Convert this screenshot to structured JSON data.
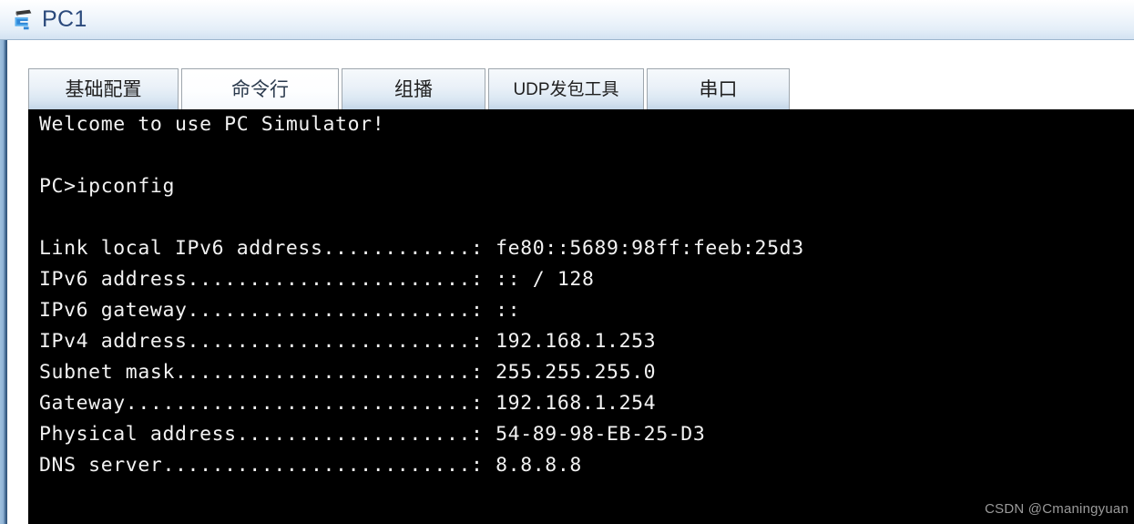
{
  "window": {
    "title": "PC1",
    "icon": "switch-icon"
  },
  "tabs": [
    {
      "label": "基础配置",
      "active": false
    },
    {
      "label": "命令行",
      "active": true
    },
    {
      "label": "组播",
      "active": false
    },
    {
      "label": "UDP发包工具",
      "active": false
    },
    {
      "label": "串口",
      "active": false
    }
  ],
  "terminal": {
    "background": "#000000",
    "foreground": "#f2f2f2",
    "label_width": 35,
    "lines": [
      {
        "text": "Welcome to use PC Simulator!"
      },
      {
        "text": ""
      },
      {
        "text": "PC>ipconfig"
      },
      {
        "text": ""
      },
      {
        "label": "Link local IPv6 address",
        "value": "fe80::5689:98ff:feeb:25d3"
      },
      {
        "label": "IPv6 address",
        "value": ":: / 128"
      },
      {
        "label": "IPv6 gateway",
        "value": "::"
      },
      {
        "label": "IPv4 address",
        "value": "192.168.1.253"
      },
      {
        "label": "Subnet mask",
        "value": "255.255.255.0"
      },
      {
        "label": "Gateway",
        "value": "192.168.1.254"
      },
      {
        "label": "Physical address",
        "value": "54-89-98-EB-25-D3"
      },
      {
        "label": "DNS server",
        "value": "8.8.8.8"
      }
    ],
    "prompt": "PC>",
    "command": "ipconfig",
    "welcome": "Welcome to use PC Simulator!"
  },
  "watermark": {
    "text": "CSDN @Cmaningyuan"
  }
}
